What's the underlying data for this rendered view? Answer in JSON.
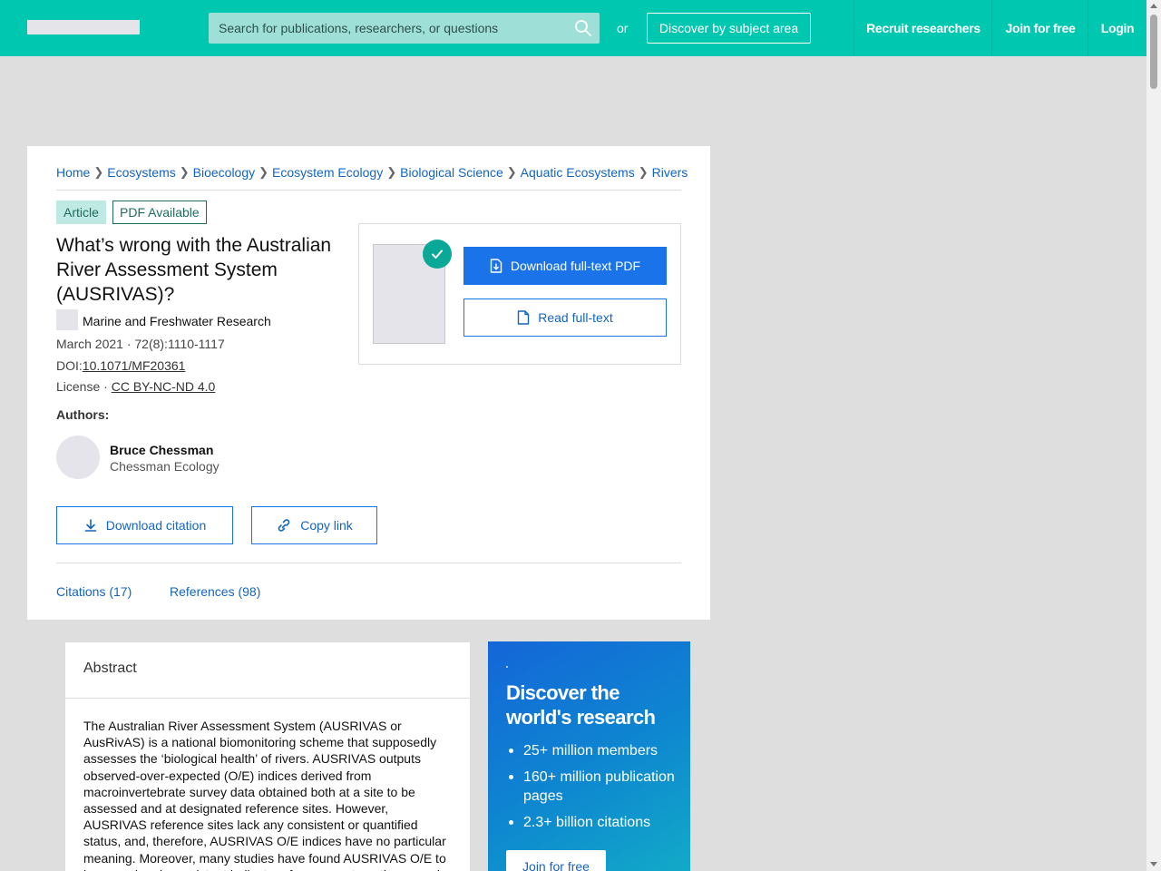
{
  "header": {
    "search_placeholder": "Search for publications, researchers, or questions",
    "or_text": "or",
    "discover_label": "Discover by subject area",
    "nav": [
      "Recruit researchers",
      "Join for free",
      "Login"
    ]
  },
  "breadcrumb": [
    "Home",
    "Ecosystems",
    "Bioecology",
    "Ecosystem Ecology",
    "Biological Science",
    "Aquatic Ecosystems",
    "Rivers"
  ],
  "article": {
    "type_badge": "Article",
    "pdf_badge": "PDF Available",
    "title": "What’s wrong with the Australian River Assessment System (AUSRIVAS)?",
    "journal": "Marine and Freshwater Research",
    "date_volume": "March 2021 · 72(8):1110-1117",
    "doi_label": "DOI:",
    "doi": "10.1071/MF20361",
    "license_label": "License · ",
    "license": "CC BY-NC-ND 4.0",
    "authors_label": "Authors:",
    "authors": [
      {
        "name": "Bruce Chessman",
        "affiliation": "Chessman Ecology"
      }
    ]
  },
  "actions": {
    "download_pdf": "Download full-text PDF",
    "read_fulltext": "Read full-text",
    "download_citation": "Download citation",
    "copy_link": "Copy link"
  },
  "tabs": [
    "Citations (17)",
    "References (98)"
  ],
  "abstract": {
    "heading": "Abstract",
    "text": "The Australian River Assessment System (AUSRIVAS or AusRivAS) is a national biomonitoring scheme that supposedly assesses the ‘biological health’ of rivers. AUSRIVAS outputs observed-over-expected (O/E) indices derived from macroinvertebrate survey data obtained both at a site to be assessed and at designated reference sites. However, AUSRIVAS reference sites lack any consistent or quantified status, and, therefore, AUSRIVAS O/E indices have no particular meaning. Moreover, many studies have found AUSRIVAS O/E to be a weak or inconsistent indicator of exposure to anthropogenic or human"
  },
  "promo": {
    "title": "Discover the world's research",
    "bullets": [
      "25+ million members",
      "160+ million publication pages",
      "2.3+ billion citations"
    ],
    "cta": "Join for free"
  },
  "colors": {
    "brand": "#00c8b0",
    "link": "#1465c0",
    "primary_button": "#1a73e8",
    "check_badge": "#0aa896"
  }
}
